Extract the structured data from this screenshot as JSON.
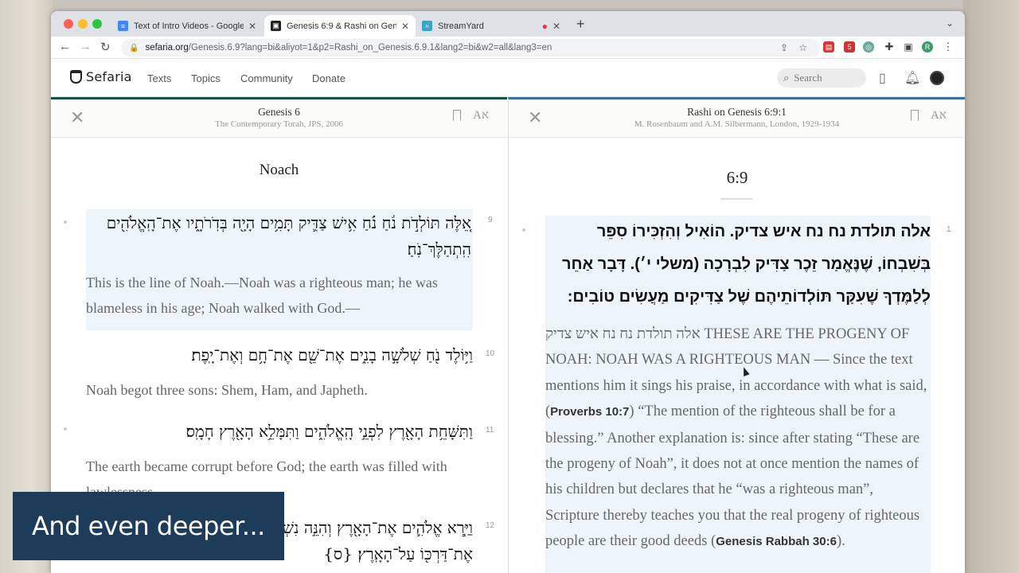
{
  "browser": {
    "tabs": [
      {
        "title": "Text of Intro Videos - Google D",
        "favicon_color": "#4285f4",
        "active": false
      },
      {
        "title": "Genesis 6:9 & Rashi on Genesi",
        "favicon_color": "#222222",
        "active": true
      },
      {
        "title": "StreamYard",
        "favicon_color": "#3aa4c7",
        "active": false
      }
    ],
    "new_tab": "+",
    "url_domain": "sefaria.org",
    "url_path": "/Genesis.6.9?lang=bi&aliyot=1&p2=Rashi_on_Genesis.6.9.1&lang2=bi&w2=all&lang3=en",
    "ext_badge": "5",
    "profile_letter": "R"
  },
  "header": {
    "logo": "Sefaria",
    "nav": [
      "Texts",
      "Topics",
      "Community",
      "Donate"
    ],
    "search_placeholder": "Search"
  },
  "left_panel": {
    "title": "Genesis 6",
    "subtitle": "The Contemporary Torah, JPS, 2006",
    "parasha": "Noach",
    "verses": [
      {
        "num": "9",
        "he": "אֵ֚לֶּה תּוֹלְדֹ֣ת נֹ֔חַ נֹ֗חַ אִ֥ישׁ צַדִּ֛יק תָּמִ֥ים הָיָ֖ה בְּדֹֽרֹתָ֑יו אֶת־הָֽאֱלֹהִ֖ים הִֽתְהַלֶּךְ־נֹֽחַ׃",
        "en": "This is the line of Noah.—Noah was a righteous man; he was blameless in his age; Noah walked with God.—"
      },
      {
        "num": "10",
        "he": "וַיּ֥וֹלֶד נֹ֖חַ שְׁלֹשָׁ֣ה בָנִ֑ים אֶת־שֵׁ֖ם אֶת־חָ֥ם וְאֶת־יָֽפֶת׃",
        "en": "Noah begot three sons: Shem, Ham, and Japheth."
      },
      {
        "num": "11",
        "he": "וַתִּשָּׁחֵ֥ת הָאָ֖רֶץ לִפְנֵ֣י הָֽאֱלֹהִ֑ים וַתִּמָּלֵ֥א הָאָ֖רֶץ חָמָֽס׃",
        "en": "The earth became corrupt before God; the earth was filled with lawlessness."
      },
      {
        "num": "12",
        "he": "וַיַּ֧רְא אֱלֹהִ֛ים אֶת־הָאָ֖רֶץ וְהִנֵּ֣ה נִשְׁחָ֑תָה כִּֽי־הִשְׁחִ֧ית כׇּל־בָּשָׂ֛ר אֶת־דַּרְכּ֖וֹ עַל־הָאָֽרֶץ׃ {ס}",
        "en": ""
      }
    ]
  },
  "right_panel": {
    "title": "Rashi on Genesis 6:9:1",
    "subtitle": "M. Rosenbaum and A.M. Silbermann, London, 1929-1934",
    "ref": "6:9",
    "comment_num": "1",
    "he": "אלה תולדת נח נח איש צדיק. הוֹאִיל וְהִזְכִּירוֹ סִפֵּר בְּשִׁבְחוֹ, שֶׁנֶּאֱמַר זֵכֶר צַדִּיק לִבְרָכָה (משלי י׳). דָּבָר אַחֵר לְלַמֶּדְךָ שֶׁעִקַּר תּוֹלְדוֹתֵיהֶם שֶׁל צַדִּיקִים מַעֲשִׂים טוֹבִים:",
    "en_lead": "אלה תולדת נח נח איש צדיק THESE ARE THE PROGENY OF NOAH: NOAH WAS A RIGHTEOUS MAN — Since the text mentions him it sings his praise, in accordance with what is said, (",
    "en_cite1": "Proverbs 10:7",
    "en_mid": ") “The mention of the righteous shall be for a blessing.” Another explanation is: since after stating “These are the progeny of Noah”, it does not at once mention the names of his children but declares that he “was a righteous man”, Scripture thereby teaches you that the real progeny of righteous people are their good deeds (",
    "en_cite2": "Genesis Rabbah 30:6",
    "en_end": ")."
  },
  "overlay": {
    "caption": "And even deeper..."
  }
}
